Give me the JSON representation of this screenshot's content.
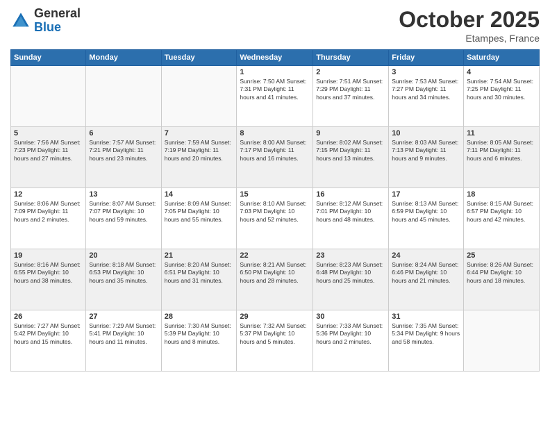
{
  "logo": {
    "general": "General",
    "blue": "Blue"
  },
  "header": {
    "month": "October 2025",
    "location": "Etampes, France"
  },
  "weekdays": [
    "Sunday",
    "Monday",
    "Tuesday",
    "Wednesday",
    "Thursday",
    "Friday",
    "Saturday"
  ],
  "weeks": [
    [
      {
        "day": "",
        "info": ""
      },
      {
        "day": "",
        "info": ""
      },
      {
        "day": "",
        "info": ""
      },
      {
        "day": "1",
        "info": "Sunrise: 7:50 AM\nSunset: 7:31 PM\nDaylight: 11 hours\nand 41 minutes."
      },
      {
        "day": "2",
        "info": "Sunrise: 7:51 AM\nSunset: 7:29 PM\nDaylight: 11 hours\nand 37 minutes."
      },
      {
        "day": "3",
        "info": "Sunrise: 7:53 AM\nSunset: 7:27 PM\nDaylight: 11 hours\nand 34 minutes."
      },
      {
        "day": "4",
        "info": "Sunrise: 7:54 AM\nSunset: 7:25 PM\nDaylight: 11 hours\nand 30 minutes."
      }
    ],
    [
      {
        "day": "5",
        "info": "Sunrise: 7:56 AM\nSunset: 7:23 PM\nDaylight: 11 hours\nand 27 minutes."
      },
      {
        "day": "6",
        "info": "Sunrise: 7:57 AM\nSunset: 7:21 PM\nDaylight: 11 hours\nand 23 minutes."
      },
      {
        "day": "7",
        "info": "Sunrise: 7:59 AM\nSunset: 7:19 PM\nDaylight: 11 hours\nand 20 minutes."
      },
      {
        "day": "8",
        "info": "Sunrise: 8:00 AM\nSunset: 7:17 PM\nDaylight: 11 hours\nand 16 minutes."
      },
      {
        "day": "9",
        "info": "Sunrise: 8:02 AM\nSunset: 7:15 PM\nDaylight: 11 hours\nand 13 minutes."
      },
      {
        "day": "10",
        "info": "Sunrise: 8:03 AM\nSunset: 7:13 PM\nDaylight: 11 hours\nand 9 minutes."
      },
      {
        "day": "11",
        "info": "Sunrise: 8:05 AM\nSunset: 7:11 PM\nDaylight: 11 hours\nand 6 minutes."
      }
    ],
    [
      {
        "day": "12",
        "info": "Sunrise: 8:06 AM\nSunset: 7:09 PM\nDaylight: 11 hours\nand 2 minutes."
      },
      {
        "day": "13",
        "info": "Sunrise: 8:07 AM\nSunset: 7:07 PM\nDaylight: 10 hours\nand 59 minutes."
      },
      {
        "day": "14",
        "info": "Sunrise: 8:09 AM\nSunset: 7:05 PM\nDaylight: 10 hours\nand 55 minutes."
      },
      {
        "day": "15",
        "info": "Sunrise: 8:10 AM\nSunset: 7:03 PM\nDaylight: 10 hours\nand 52 minutes."
      },
      {
        "day": "16",
        "info": "Sunrise: 8:12 AM\nSunset: 7:01 PM\nDaylight: 10 hours\nand 48 minutes."
      },
      {
        "day": "17",
        "info": "Sunrise: 8:13 AM\nSunset: 6:59 PM\nDaylight: 10 hours\nand 45 minutes."
      },
      {
        "day": "18",
        "info": "Sunrise: 8:15 AM\nSunset: 6:57 PM\nDaylight: 10 hours\nand 42 minutes."
      }
    ],
    [
      {
        "day": "19",
        "info": "Sunrise: 8:16 AM\nSunset: 6:55 PM\nDaylight: 10 hours\nand 38 minutes."
      },
      {
        "day": "20",
        "info": "Sunrise: 8:18 AM\nSunset: 6:53 PM\nDaylight: 10 hours\nand 35 minutes."
      },
      {
        "day": "21",
        "info": "Sunrise: 8:20 AM\nSunset: 6:51 PM\nDaylight: 10 hours\nand 31 minutes."
      },
      {
        "day": "22",
        "info": "Sunrise: 8:21 AM\nSunset: 6:50 PM\nDaylight: 10 hours\nand 28 minutes."
      },
      {
        "day": "23",
        "info": "Sunrise: 8:23 AM\nSunset: 6:48 PM\nDaylight: 10 hours\nand 25 minutes."
      },
      {
        "day": "24",
        "info": "Sunrise: 8:24 AM\nSunset: 6:46 PM\nDaylight: 10 hours\nand 21 minutes."
      },
      {
        "day": "25",
        "info": "Sunrise: 8:26 AM\nSunset: 6:44 PM\nDaylight: 10 hours\nand 18 minutes."
      }
    ],
    [
      {
        "day": "26",
        "info": "Sunrise: 7:27 AM\nSunset: 5:42 PM\nDaylight: 10 hours\nand 15 minutes."
      },
      {
        "day": "27",
        "info": "Sunrise: 7:29 AM\nSunset: 5:41 PM\nDaylight: 10 hours\nand 11 minutes."
      },
      {
        "day": "28",
        "info": "Sunrise: 7:30 AM\nSunset: 5:39 PM\nDaylight: 10 hours\nand 8 minutes."
      },
      {
        "day": "29",
        "info": "Sunrise: 7:32 AM\nSunset: 5:37 PM\nDaylight: 10 hours\nand 5 minutes."
      },
      {
        "day": "30",
        "info": "Sunrise: 7:33 AM\nSunset: 5:36 PM\nDaylight: 10 hours\nand 2 minutes."
      },
      {
        "day": "31",
        "info": "Sunrise: 7:35 AM\nSunset: 5:34 PM\nDaylight: 9 hours\nand 58 minutes."
      },
      {
        "day": "",
        "info": ""
      }
    ]
  ]
}
